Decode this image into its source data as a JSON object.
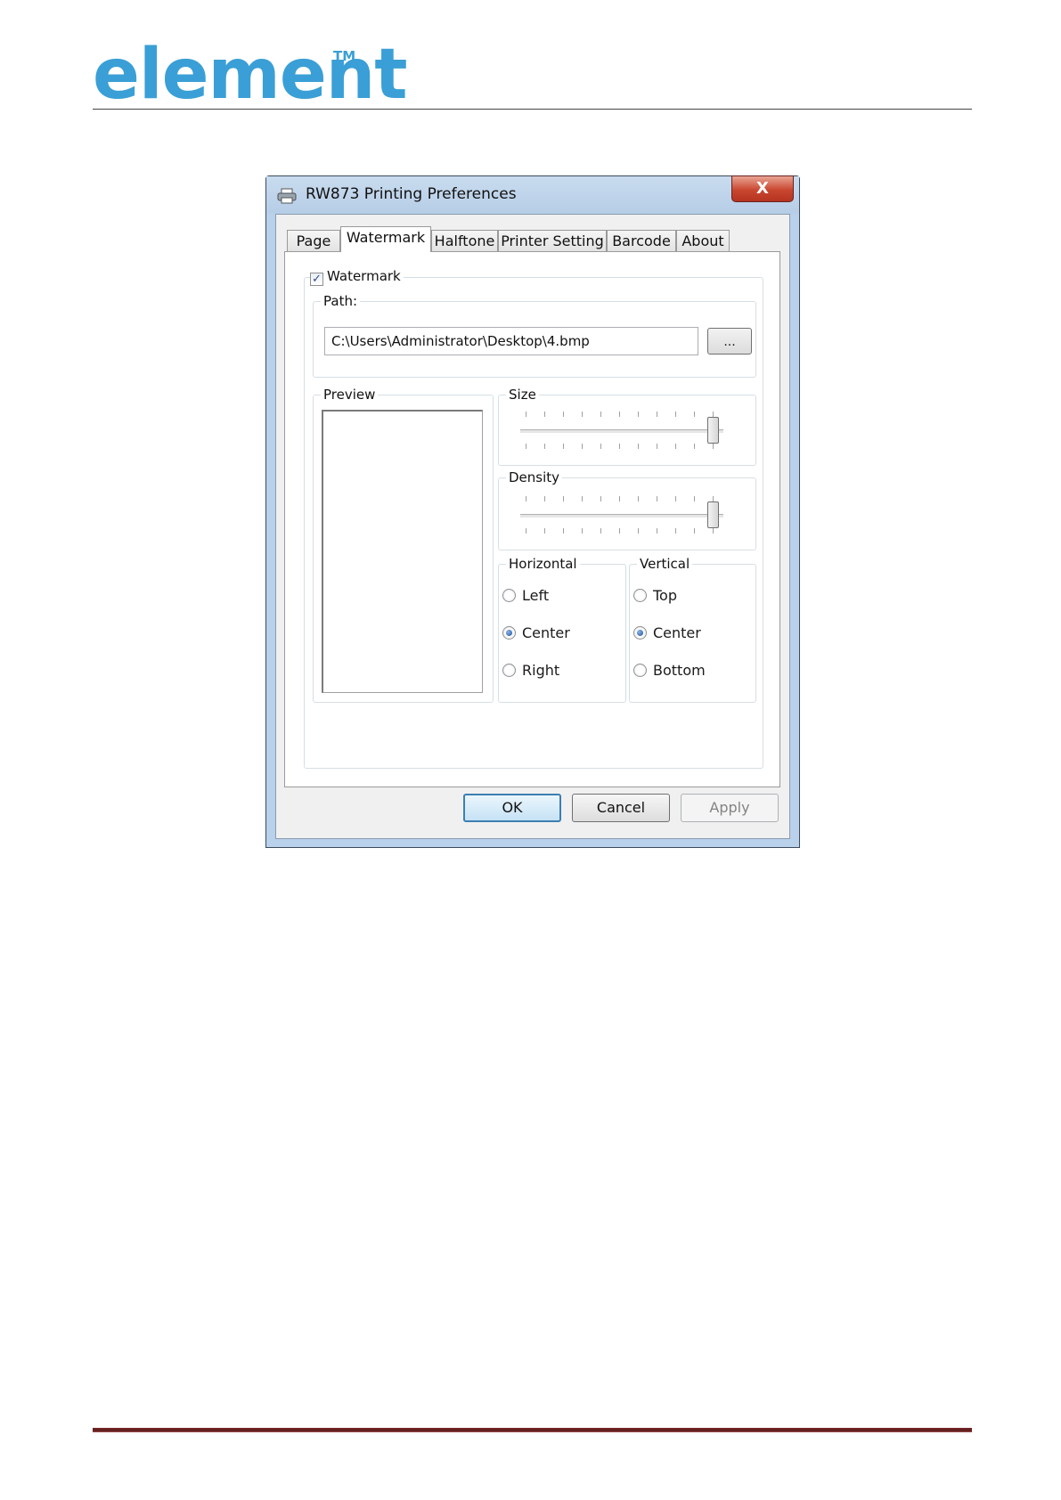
{
  "brand": {
    "logo_text": "element",
    "trademark": "TM"
  },
  "dialog": {
    "title": "RW873 Printing Preferences",
    "close_label": "X",
    "tabs": [
      {
        "label": "Page"
      },
      {
        "label": "Watermark"
      },
      {
        "label": "Halftone"
      },
      {
        "label": "Printer Setting"
      },
      {
        "label": "Barcode"
      },
      {
        "label": "About"
      }
    ],
    "active_tab": "Watermark",
    "watermark": {
      "enabled_label": "Watermark",
      "enabled": true,
      "check_mark": "✓",
      "path_label": "Path:",
      "path_value": "C:\\Users\\Administrator\\Desktop\\4.bmp",
      "browse_label": "...",
      "preview_label": "Preview",
      "size_label": "Size",
      "size_value": 1.0,
      "density_label": "Density",
      "density_value": 1.0,
      "horizontal": {
        "label": "Horizontal",
        "options": [
          "Left",
          "Center",
          "Right"
        ],
        "selected": "Center"
      },
      "vertical": {
        "label": "Vertical",
        "options": [
          "Top",
          "Center",
          "Bottom"
        ],
        "selected": "Center"
      }
    },
    "buttons": {
      "ok": "OK",
      "cancel": "Cancel",
      "apply": "Apply"
    }
  },
  "colors": {
    "brand": "#3a9fd6",
    "footer_rule": "#7a2a2a",
    "close_button": "#c9462f"
  }
}
